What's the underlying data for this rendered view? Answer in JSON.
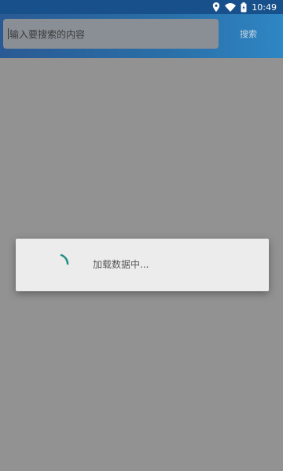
{
  "status_bar": {
    "time": "10:49",
    "icons": [
      "location-icon",
      "wifi-icon",
      "battery-icon"
    ]
  },
  "search": {
    "placeholder": "输入要搜索的内容",
    "button_label": "搜索"
  },
  "loading_dialog": {
    "message": "加载数据中..."
  },
  "colors": {
    "status_bar": "#17508a",
    "app_bar": "#2a6fa8",
    "spinner": "#1f8f84",
    "overlay": "#929292"
  }
}
